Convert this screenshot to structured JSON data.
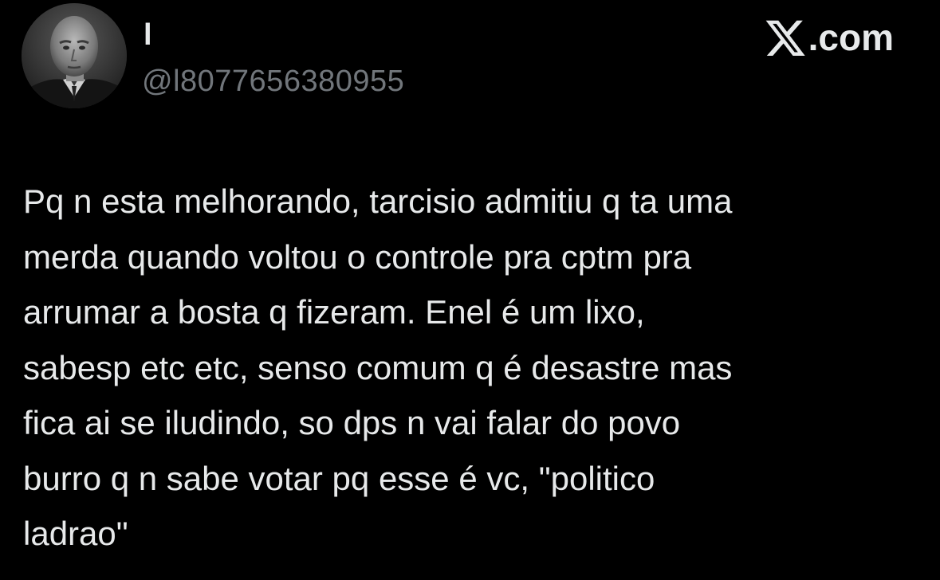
{
  "author": {
    "display_name": "l",
    "handle": "@l8077656380955",
    "avatar": "avatar-photo-bald-man-grayscale"
  },
  "brand": {
    "label": ".com",
    "icon": "x-logo-icon"
  },
  "tweet": {
    "text": "Pq n esta melhorando, tarcisio admitiu q ta uma\nmerda quando voltou o controle pra cptm pra\narrumar a bosta q fizeram. Enel é um lixo,\nsabesp etc etc, senso comum q é desastre mas\nfica ai se iludindo, so dps n vai falar do povo\nburro q n sabe votar pq esse é vc, \"politico\nladrao\""
  },
  "colors": {
    "background": "#000000",
    "text_primary": "#e7e9ea",
    "text_secondary": "#71767b"
  }
}
